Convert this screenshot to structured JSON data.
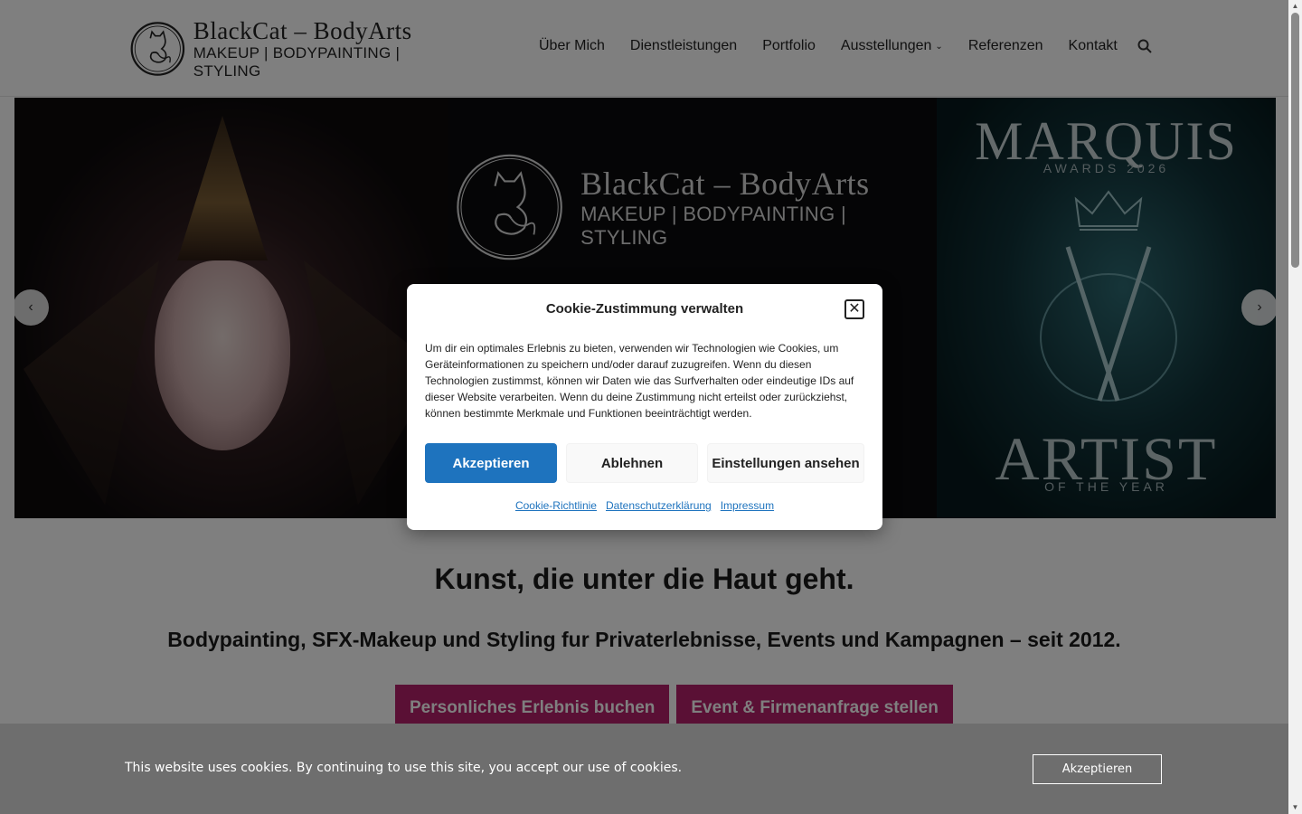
{
  "header": {
    "logo_title": "BlackCat – BodyArts",
    "logo_sub": "MAKEUP | BODYPAINTING | STYLING",
    "nav": [
      {
        "label": "Über Mich"
      },
      {
        "label": "Dienstleistungen"
      },
      {
        "label": "Portfolio"
      },
      {
        "label": "Ausstellungen"
      },
      {
        "label": "Referenzen"
      },
      {
        "label": "Kontakt"
      }
    ]
  },
  "hero": {
    "logo_title": "BlackCat – BodyArts",
    "logo_sub": "MAKEUP | BODYPAINTING | STYLING",
    "award_top": "MARQUIS",
    "award_year": "AWARDS 2026",
    "award_main": "ARTIST",
    "award_sub": "OF THE YEAR"
  },
  "main": {
    "headline": "Kunst, die unter die Haut geht.",
    "subline": "Bodypainting, SFX-Makeup und Styling fur Privaterlebnisse, Events und Kampagnen – seit 2012.",
    "cta_primary": "Personliches Erlebnis buchen",
    "cta_secondary": "Event & Firmenanfrage stellen"
  },
  "modal": {
    "title": "Cookie-Zustimmung verwalten",
    "body": "Um dir ein optimales Erlebnis zu bieten, verwenden wir Technologien wie Cookies, um Geräteinformationen zu speichern und/oder darauf zuzugreifen. Wenn du diesen Technologien zustimmst, können wir Daten wie das Surfverhalten oder eindeutige IDs auf dieser Website verarbeiten. Wenn du deine Zustimmung nicht erteilst oder zurückziehst, können bestimmte Merkmale und Funktionen beeinträchtigt werden.",
    "accept": "Akzeptieren",
    "deny": "Ablehnen",
    "settings": "Einstellungen ansehen",
    "links": [
      "Cookie-Richtlinie",
      "Datenschutzerklärung",
      "Impressum"
    ]
  },
  "cookie_bar": {
    "text": "This website uses cookies. By continuing to use this site, you accept our use of cookies.",
    "button": "Akzeptieren"
  },
  "colors": {
    "accent_blue": "#1e73be",
    "cta_magenta": "#b5206a"
  }
}
